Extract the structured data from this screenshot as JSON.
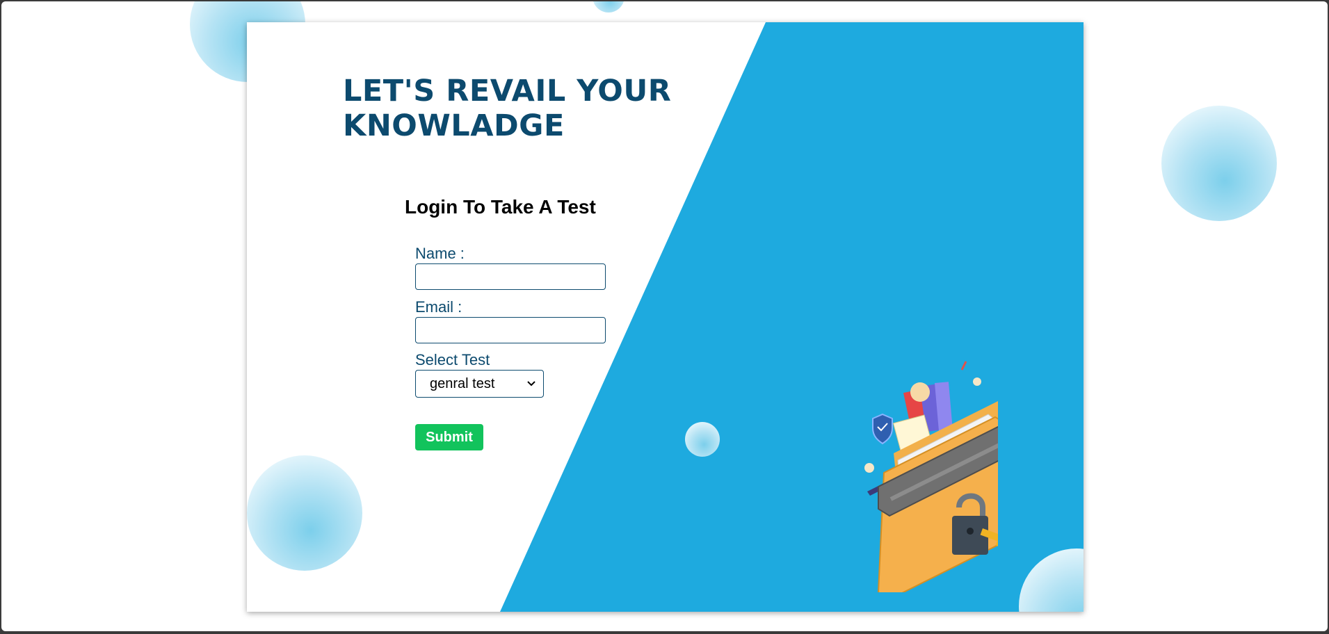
{
  "hero": {
    "headline_line1": "LET'S REVAIL YOUR",
    "headline_line2": "KNOWLADGE"
  },
  "form": {
    "title": "Login To Take A Test",
    "name_label": "Name :",
    "name_value": "",
    "email_label": "Email :",
    "email_value": "",
    "test_label": "Select Test",
    "test_selected": "genral test",
    "submit_label": "Submit"
  },
  "illustration": {
    "icon": "locked-folder-with-key-icon"
  },
  "colors": {
    "accent_blue": "#1eaadf",
    "heading_navy": "#0c4a6e",
    "submit_green": "#12c35c"
  }
}
